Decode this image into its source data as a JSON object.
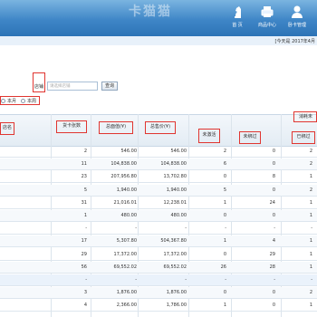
{
  "header": {
    "watermark": "卡猫猫",
    "nav": [
      {
        "label": "首 页",
        "icon": "chess-knight-icon"
      },
      {
        "label": "商品中心",
        "icon": "printer-icon"
      },
      {
        "label": "卧卡管理",
        "icon": "user-icon"
      }
    ]
  },
  "subbar": {
    "info": "[今天是 2017年4月"
  },
  "filter": {
    "shop_label": "店铺",
    "shop_placeholder": "请选择店铺",
    "query_button": "查询",
    "period_this_month": "本月",
    "period_this_week": "本周"
  },
  "table": {
    "columns": {
      "name": "店名",
      "goods_count": "货卡张数",
      "face_value": "总面值(¥)",
      "total_price": "总售价(¥)",
      "unused": "未激活",
      "unlinked": "未绑过",
      "linked": "已绑过",
      "consumed": "消耗未"
    },
    "rows": [
      {
        "count": "2",
        "face": "546.00",
        "price": "546.00",
        "a": "2",
        "b": "0",
        "c": "2"
      },
      {
        "count": "11",
        "face": "104,838.00",
        "price": "104,838.00",
        "a": "6",
        "b": "0",
        "c": "2"
      },
      {
        "count": "23",
        "face": "207,956.80",
        "price": "13,702.80",
        "a": "0",
        "b": "8",
        "c": "1"
      },
      {
        "count": "5",
        "face": "1,940.00",
        "price": "1,940.00",
        "a": "5",
        "b": "0",
        "c": "2"
      },
      {
        "count": "31",
        "face": "21,016.01",
        "price": "12,238.01",
        "a": "1",
        "b": "24",
        "c": "1"
      },
      {
        "count": "1",
        "face": "480.00",
        "price": "480.00",
        "a": "0",
        "b": "0",
        "c": "1"
      },
      {
        "count": "-",
        "face": "-",
        "price": "-",
        "a": "-",
        "b": "-",
        "c": "-"
      },
      {
        "count": "17",
        "face": "5,307.80",
        "price": "504,367.80",
        "a": "1",
        "b": "4",
        "c": "1"
      },
      {
        "count": "29",
        "face": "17,372.00",
        "price": "17,372.00",
        "a": "0",
        "b": "29",
        "c": "1"
      },
      {
        "count": "56",
        "face": "69,552.02",
        "price": "69,552.02",
        "a": "26",
        "b": "28",
        "c": "1"
      },
      {
        "count": "-",
        "face": "-",
        "price": "-",
        "a": "-",
        "b": "-",
        "c": "-"
      },
      {
        "count": "3",
        "face": "1,876.00",
        "price": "1,876.00",
        "a": "0",
        "b": "0",
        "c": "2"
      },
      {
        "count": "4",
        "face": "2,366.00",
        "price": "1,786.00",
        "a": "1",
        "b": "0",
        "c": "1"
      }
    ]
  }
}
